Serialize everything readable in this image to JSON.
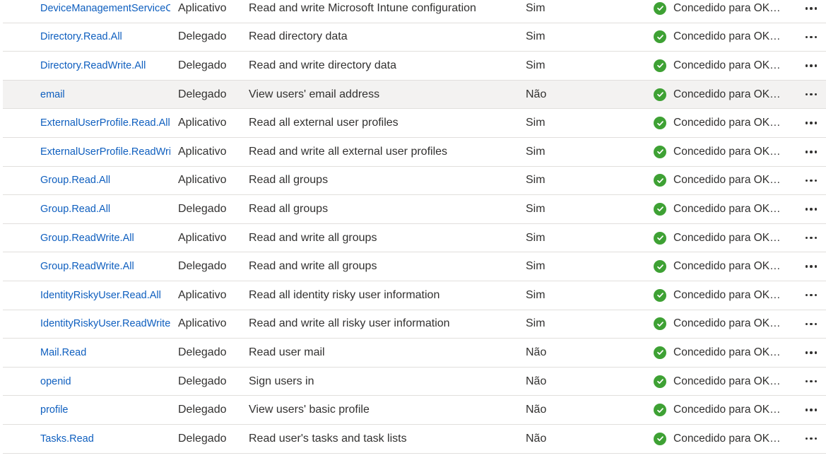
{
  "permissions": [
    {
      "name": "DeviceManagementServiceConfig.ReadWrite.All",
      "type": "Aplicativo",
      "description": "Read and write Microsoft Intune configuration",
      "admin_consent": "Sim",
      "status": "Concedido para OKEANOS"
    },
    {
      "name": "Directory.Read.All",
      "type": "Delegado",
      "description": "Read directory data",
      "admin_consent": "Sim",
      "status": "Concedido para OKEANOS"
    },
    {
      "name": "Directory.ReadWrite.All",
      "type": "Delegado",
      "description": "Read and write directory data",
      "admin_consent": "Sim",
      "status": "Concedido para OKEANOS"
    },
    {
      "name": "email",
      "type": "Delegado",
      "description": "View users' email address",
      "admin_consent": "Não",
      "status": "Concedido para OKEANOS"
    },
    {
      "name": "ExternalUserProfile.Read.All",
      "type": "Aplicativo",
      "description": "Read all external user profiles",
      "admin_consent": "Sim",
      "status": "Concedido para OKEANOS"
    },
    {
      "name": "ExternalUserProfile.ReadWrite.All",
      "type": "Aplicativo",
      "description": "Read and write all external user profiles",
      "admin_consent": "Sim",
      "status": "Concedido para OKEANOS"
    },
    {
      "name": "Group.Read.All",
      "type": "Aplicativo",
      "description": "Read all groups",
      "admin_consent": "Sim",
      "status": "Concedido para OKEANOS"
    },
    {
      "name": "Group.Read.All",
      "type": "Delegado",
      "description": "Read all groups",
      "admin_consent": "Sim",
      "status": "Concedido para OKEANOS"
    },
    {
      "name": "Group.ReadWrite.All",
      "type": "Aplicativo",
      "description": "Read and write all groups",
      "admin_consent": "Sim",
      "status": "Concedido para OKEANOS"
    },
    {
      "name": "Group.ReadWrite.All",
      "type": "Delegado",
      "description": "Read and write all groups",
      "admin_consent": "Sim",
      "status": "Concedido para OKEANOS"
    },
    {
      "name": "IdentityRiskyUser.Read.All",
      "type": "Aplicativo",
      "description": "Read all identity risky user information",
      "admin_consent": "Sim",
      "status": "Concedido para OKEANOS"
    },
    {
      "name": "IdentityRiskyUser.ReadWrite.All",
      "type": "Aplicativo",
      "description": "Read and write all risky user information",
      "admin_consent": "Sim",
      "status": "Concedido para OKEANOS"
    },
    {
      "name": "Mail.Read",
      "type": "Delegado",
      "description": "Read user mail",
      "admin_consent": "Não",
      "status": "Concedido para OKEANOS"
    },
    {
      "name": "openid",
      "type": "Delegado",
      "description": "Sign users in",
      "admin_consent": "Não",
      "status": "Concedido para OKEANOS"
    },
    {
      "name": "profile",
      "type": "Delegado",
      "description": "View users' basic profile",
      "admin_consent": "Não",
      "status": "Concedido para OKEANOS"
    },
    {
      "name": "Tasks.Read",
      "type": "Delegado",
      "description": "Read user's tasks and task lists",
      "admin_consent": "Não",
      "status": "Concedido para OKEANOS"
    }
  ],
  "icons": {
    "status": "check-circle-icon",
    "more": "more-horizontal-icon"
  },
  "colors": {
    "link": "#0f5fbf",
    "granted": "#3ea134",
    "selected_row": "#f3f2f1"
  }
}
